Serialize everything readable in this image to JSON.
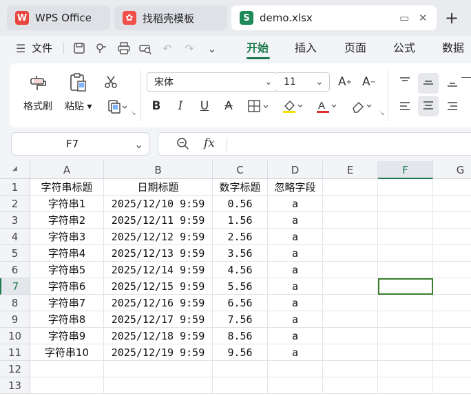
{
  "tabs": [
    {
      "label": "WPS Office",
      "icon": "wps-logo-icon"
    },
    {
      "label": "找稻壳模板",
      "icon": "docer-icon"
    },
    {
      "label": "demo.xlsx",
      "icon": "spreadsheet-s-icon"
    }
  ],
  "menu": {
    "file_label": "文件",
    "items": [
      "开始",
      "插入",
      "页面",
      "公式",
      "数据"
    ],
    "active": "开始"
  },
  "ribbon": {
    "format_painter": "格式刷",
    "paste": "粘贴",
    "font_name": "宋体",
    "font_size": "11"
  },
  "namebox": {
    "value": "F7"
  },
  "formula": {
    "fx_label": "fx",
    "value": ""
  },
  "sheet": {
    "columns": [
      "A",
      "B",
      "C",
      "D",
      "E",
      "F",
      "G"
    ],
    "selected_column": "F",
    "selected_row": "7",
    "rows": [
      {
        "num": "1",
        "cells": [
          "字符串标题",
          "日期标题",
          "数字标题",
          "忽略字段",
          "",
          "",
          ""
        ]
      },
      {
        "num": "2",
        "cells": [
          "字符串1",
          "2025/12/10 9:59",
          "0.56",
          "a",
          "",
          "",
          ""
        ]
      },
      {
        "num": "3",
        "cells": [
          "字符串2",
          "2025/12/11 9:59",
          "1.56",
          "a",
          "",
          "",
          ""
        ]
      },
      {
        "num": "4",
        "cells": [
          "字符串3",
          "2025/12/12 9:59",
          "2.56",
          "a",
          "",
          "",
          ""
        ]
      },
      {
        "num": "5",
        "cells": [
          "字符串4",
          "2025/12/13 9:59",
          "3.56",
          "a",
          "",
          "",
          ""
        ]
      },
      {
        "num": "6",
        "cells": [
          "字符串5",
          "2025/12/14 9:59",
          "4.56",
          "a",
          "",
          "",
          ""
        ]
      },
      {
        "num": "7",
        "cells": [
          "字符串6",
          "2025/12/15 9:59",
          "5.56",
          "a",
          "",
          "",
          ""
        ]
      },
      {
        "num": "8",
        "cells": [
          "字符串7",
          "2025/12/16 9:59",
          "6.56",
          "a",
          "",
          "",
          ""
        ]
      },
      {
        "num": "9",
        "cells": [
          "字符串8",
          "2025/12/17 9:59",
          "7.56",
          "a",
          "",
          "",
          ""
        ]
      },
      {
        "num": "10",
        "cells": [
          "字符串9",
          "2025/12/18 9:59",
          "8.56",
          "a",
          "",
          "",
          ""
        ]
      },
      {
        "num": "11",
        "cells": [
          "字符串10",
          "2025/12/19 9:59",
          "9.56",
          "a",
          "",
          "",
          ""
        ]
      },
      {
        "num": "12",
        "cells": [
          "",
          "",
          "",
          "",
          "",
          "",
          ""
        ]
      },
      {
        "num": "13",
        "cells": [
          "",
          "",
          "",
          "",
          "",
          "",
          ""
        ]
      }
    ]
  },
  "colors": {
    "accent": "#1f7a4d",
    "selection": "#3a7d2c",
    "wps_red": "#e8453c",
    "docer_red": "#f0504a"
  }
}
